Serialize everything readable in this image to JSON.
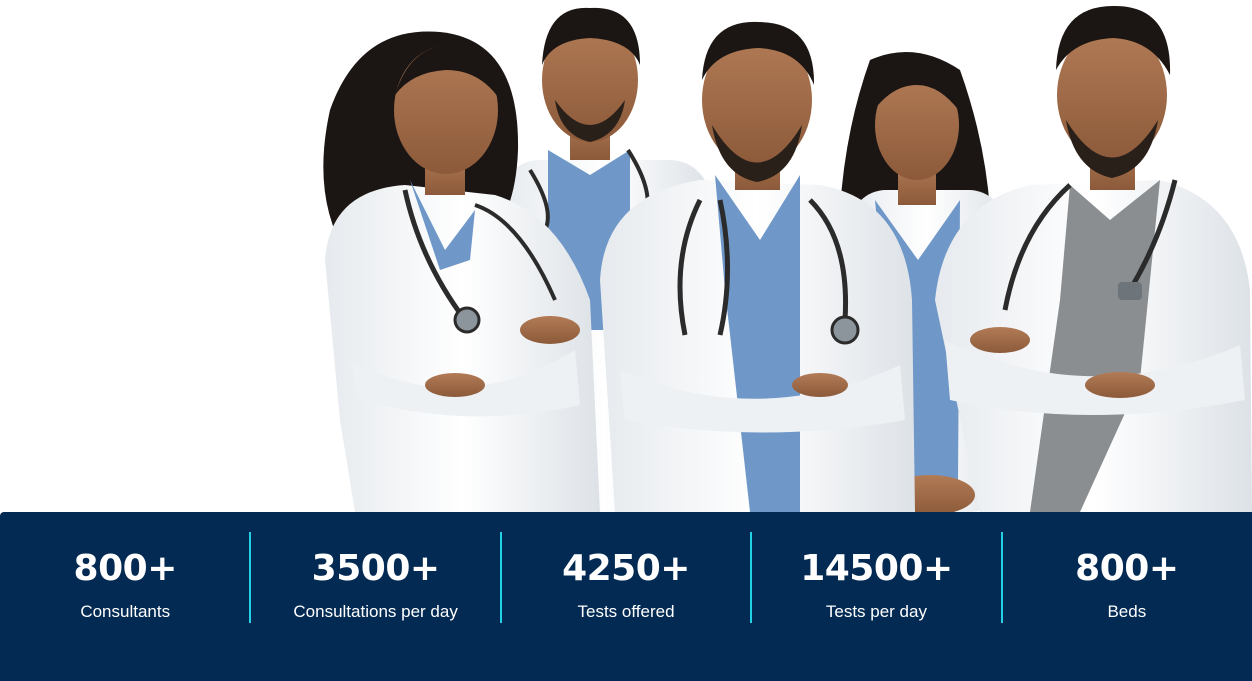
{
  "hero": {
    "image_alt": "Team of doctors in white lab coats with stethoscopes"
  },
  "stats": [
    {
      "value": "800+",
      "label": "Consultants"
    },
    {
      "value": "3500+",
      "label": "Consultations per day"
    },
    {
      "value": "4250+",
      "label": "Tests offered"
    },
    {
      "value": "14500+",
      "label": "Tests per day"
    },
    {
      "value": "800+",
      "label": "Beds"
    }
  ],
  "colors": {
    "stats_background": "#032a52",
    "divider": "#22d1e6",
    "text": "#ffffff",
    "coat": "#f3f5f7",
    "scrubs": "#6f98c9",
    "skin": "#a8714c",
    "hair": "#1b1613"
  }
}
